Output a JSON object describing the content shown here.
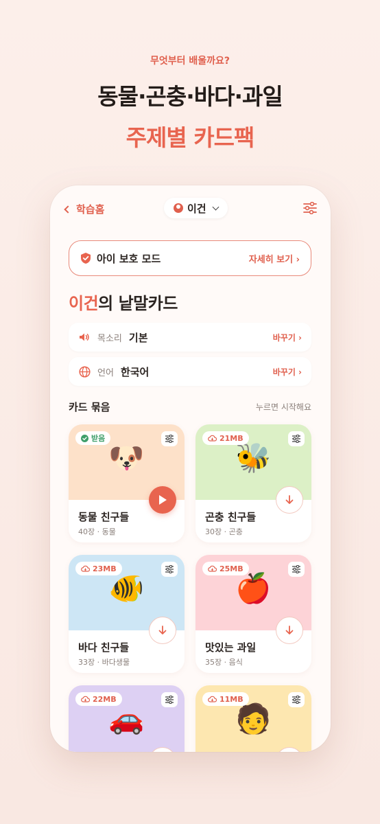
{
  "promo": {
    "eyebrow": "무엇부터 배울까요?",
    "line1": "동물·곤충·바다·과일",
    "line2": "주제별 카드팩"
  },
  "topbar": {
    "back_label": "학습홈",
    "profile_name": "이건"
  },
  "safe_mode": {
    "label": "아이 보호 모드",
    "detail": "자세히 보기 ›"
  },
  "heading": {
    "name": "이건",
    "suffix": "의 낱말카드"
  },
  "settings": [
    {
      "key": "목소리",
      "value": "기본",
      "change": "바꾸기 ›",
      "icon": "speaker-icon"
    },
    {
      "key": "언어",
      "value": "한국어",
      "change": "바꾸기 ›",
      "icon": "globe-icon"
    }
  ],
  "section": {
    "title": "카드 묶음",
    "hint": "누르면 시작해요"
  },
  "cards": [
    {
      "badge": "받음",
      "downloaded": true,
      "emoji": "🐶",
      "title": "동물 친구들",
      "meta": "40장 · 동물",
      "bg": "#fde1c9",
      "action": "play"
    },
    {
      "badge": "21MB",
      "downloaded": false,
      "emoji": "🐝",
      "title": "곤충 친구들",
      "meta": "30장 · 곤충",
      "bg": "#dcf0c6",
      "action": "download"
    },
    {
      "badge": "23MB",
      "downloaded": false,
      "emoji": "🐠",
      "title": "바다 친구들",
      "meta": "33장 · 바다생물",
      "bg": "#cde6f5",
      "action": "download"
    },
    {
      "badge": "25MB",
      "downloaded": false,
      "emoji": "🍎",
      "title": "맛있는 과일",
      "meta": "35장 · 음식",
      "bg": "#fdd3d7",
      "action": "download"
    },
    {
      "badge": "22MB",
      "downloaded": false,
      "emoji": "🚗",
      "title": "",
      "meta": "",
      "bg": "#ddd0f3",
      "action": "download"
    },
    {
      "badge": "11MB",
      "downloaded": false,
      "emoji": "🧑",
      "title": "",
      "meta": "",
      "bg": "#fde7b0",
      "action": "download"
    }
  ],
  "colors": {
    "accent": "#e8644f",
    "background": "#fcefea",
    "success": "#3f9f6a"
  }
}
